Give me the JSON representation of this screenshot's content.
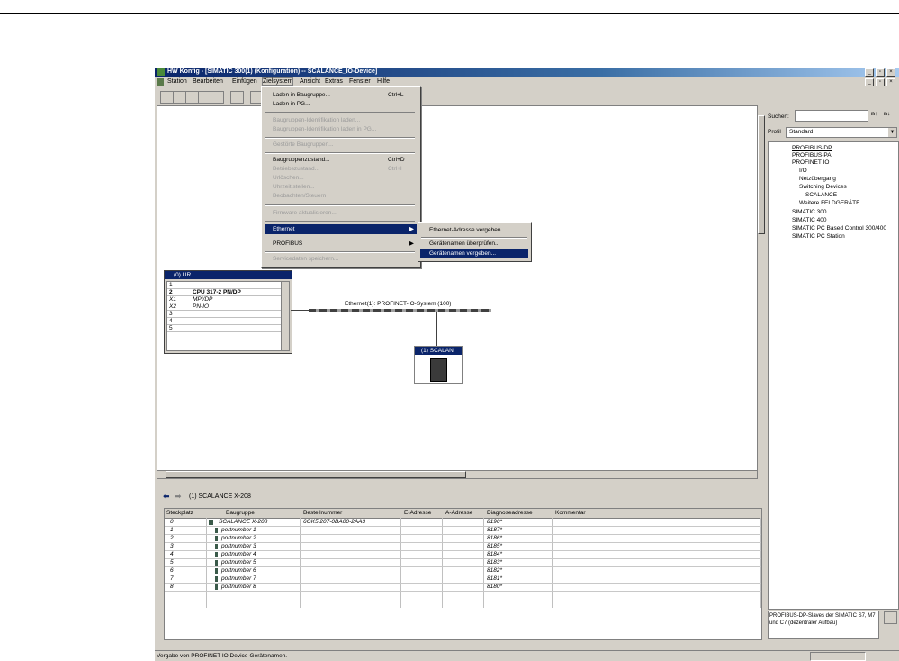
{
  "app": {
    "title": "HW Konfig - [SIMATIC 300(1) (Konfiguration) -- SCALANCE_IO-Device]",
    "win_buttons": [
      "_",
      "̅",
      "×"
    ],
    "doc_buttons": [
      "_",
      "̅",
      "×"
    ]
  },
  "menubar": [
    "Station",
    "Bearbeiten",
    "Einfügen",
    "Zielsystem",
    "Ansicht",
    "Extras",
    "Fenster",
    "Hilfe"
  ],
  "menu": {
    "items": [
      {
        "label": "Laden in Baugruppe...",
        "shortcut": "Ctrl+L",
        "enabled": true
      },
      {
        "label": "Laden in PG...",
        "shortcut": "",
        "enabled": true
      },
      {
        "label": "Baugruppen-Identifikation laden...",
        "shortcut": "",
        "enabled": false
      },
      {
        "label": "Baugruppen-Identifikation laden in PG...",
        "shortcut": "",
        "enabled": false
      },
      {
        "label": "Gestörte Baugruppen...",
        "shortcut": "",
        "enabled": false
      },
      {
        "label": "Baugruppenzustand...",
        "shortcut": "Ctrl+D",
        "enabled": true
      },
      {
        "label": "Betriebszustand...",
        "shortcut": "Ctrl+I",
        "enabled": false
      },
      {
        "label": "Urlöschen...",
        "shortcut": "",
        "enabled": false
      },
      {
        "label": "Uhrzeit stellen...",
        "shortcut": "",
        "enabled": false
      },
      {
        "label": "Beobachten/Steuern",
        "shortcut": "",
        "enabled": false
      },
      {
        "label": "Firmware aktualisieren...",
        "shortcut": "",
        "enabled": false
      },
      {
        "label": "Ethernet",
        "shortcut": "",
        "enabled": true
      },
      {
        "label": "PROFIBUS",
        "shortcut": "",
        "enabled": true
      },
      {
        "label": "Servicedaten speichern...",
        "shortcut": "",
        "enabled": false
      }
    ]
  },
  "submenu": {
    "items": [
      "Ethernet-Adresse vergeben...",
      "Gerätenamen überprüfen...",
      "Gerätenamen vergeben..."
    ]
  },
  "rack": {
    "title": "(0) UR",
    "rows": [
      {
        "slot": "1",
        "name": ""
      },
      {
        "slot": "2",
        "name": "CPU 317-2 PN/DP"
      },
      {
        "slot": "X1",
        "name": "MPI/DP"
      },
      {
        "slot": "X2",
        "name": "PN-IO"
      },
      {
        "slot": "3",
        "name": ""
      },
      {
        "slot": "4",
        "name": ""
      },
      {
        "slot": "5",
        "name": ""
      }
    ]
  },
  "network": {
    "label": "Ethernet(1): PROFINET-IO-System (100)"
  },
  "device": {
    "label": "(1) SCALAN"
  },
  "catalog": {
    "search_label": "Suchen:",
    "profile_label": "Profil",
    "profile_value": "Standard",
    "tree": [
      {
        "label": "PROFIBUS-DP",
        "level": 0
      },
      {
        "label": "PROFIBUS-PA",
        "level": 0
      },
      {
        "label": "PROFINET IO",
        "level": 0
      },
      {
        "label": "I/O",
        "level": 1
      },
      {
        "label": "Netzübergang",
        "level": 1
      },
      {
        "label": "Switching Devices",
        "level": 1
      },
      {
        "label": "SCALANCE",
        "level": 2
      },
      {
        "label": "Weitere FELDGERÄTE",
        "level": 1
      },
      {
        "label": "SIMATIC 300",
        "level": 0
      },
      {
        "label": "SIMATIC 400",
        "level": 0
      },
      {
        "label": "SIMATIC PC Based Control 300/400",
        "level": 0
      },
      {
        "label": "SIMATIC PC Station",
        "level": 0
      }
    ],
    "info": "PROFIBUS-DP-Slaves der SIMATIC S7, M7 und C7 (dezentraler Aufbau)"
  },
  "bottom": {
    "title": "(1)   SCALANCE X-208",
    "columns": [
      "Steckplatz",
      "Baugruppe",
      "Bestellnummer",
      "E-Adresse",
      "A-Adresse",
      "Diagnoseadresse",
      "Kommentar"
    ],
    "rows": [
      [
        "0",
        "SCALANCE X-208",
        "6GK5 207-0BA00-2AA3",
        "",
        "",
        "8190*",
        ""
      ],
      [
        "1",
        "portnumber 1",
        "",
        "",
        "",
        "8187*",
        ""
      ],
      [
        "2",
        "portnumber 2",
        "",
        "",
        "",
        "8186*",
        ""
      ],
      [
        "3",
        "portnumber 3",
        "",
        "",
        "",
        "8185*",
        ""
      ],
      [
        "4",
        "portnumber 4",
        "",
        "",
        "",
        "8184*",
        ""
      ],
      [
        "5",
        "portnumber 5",
        "",
        "",
        "",
        "8183*",
        ""
      ],
      [
        "6",
        "portnumber 6",
        "",
        "",
        "",
        "8182*",
        ""
      ],
      [
        "7",
        "portnumber 7",
        "",
        "",
        "",
        "8181*",
        ""
      ],
      [
        "8",
        "portnumber 8",
        "",
        "",
        "",
        "8180*",
        ""
      ]
    ]
  },
  "status": "Vergabe von PROFINET IO Device-Gerätenamen."
}
